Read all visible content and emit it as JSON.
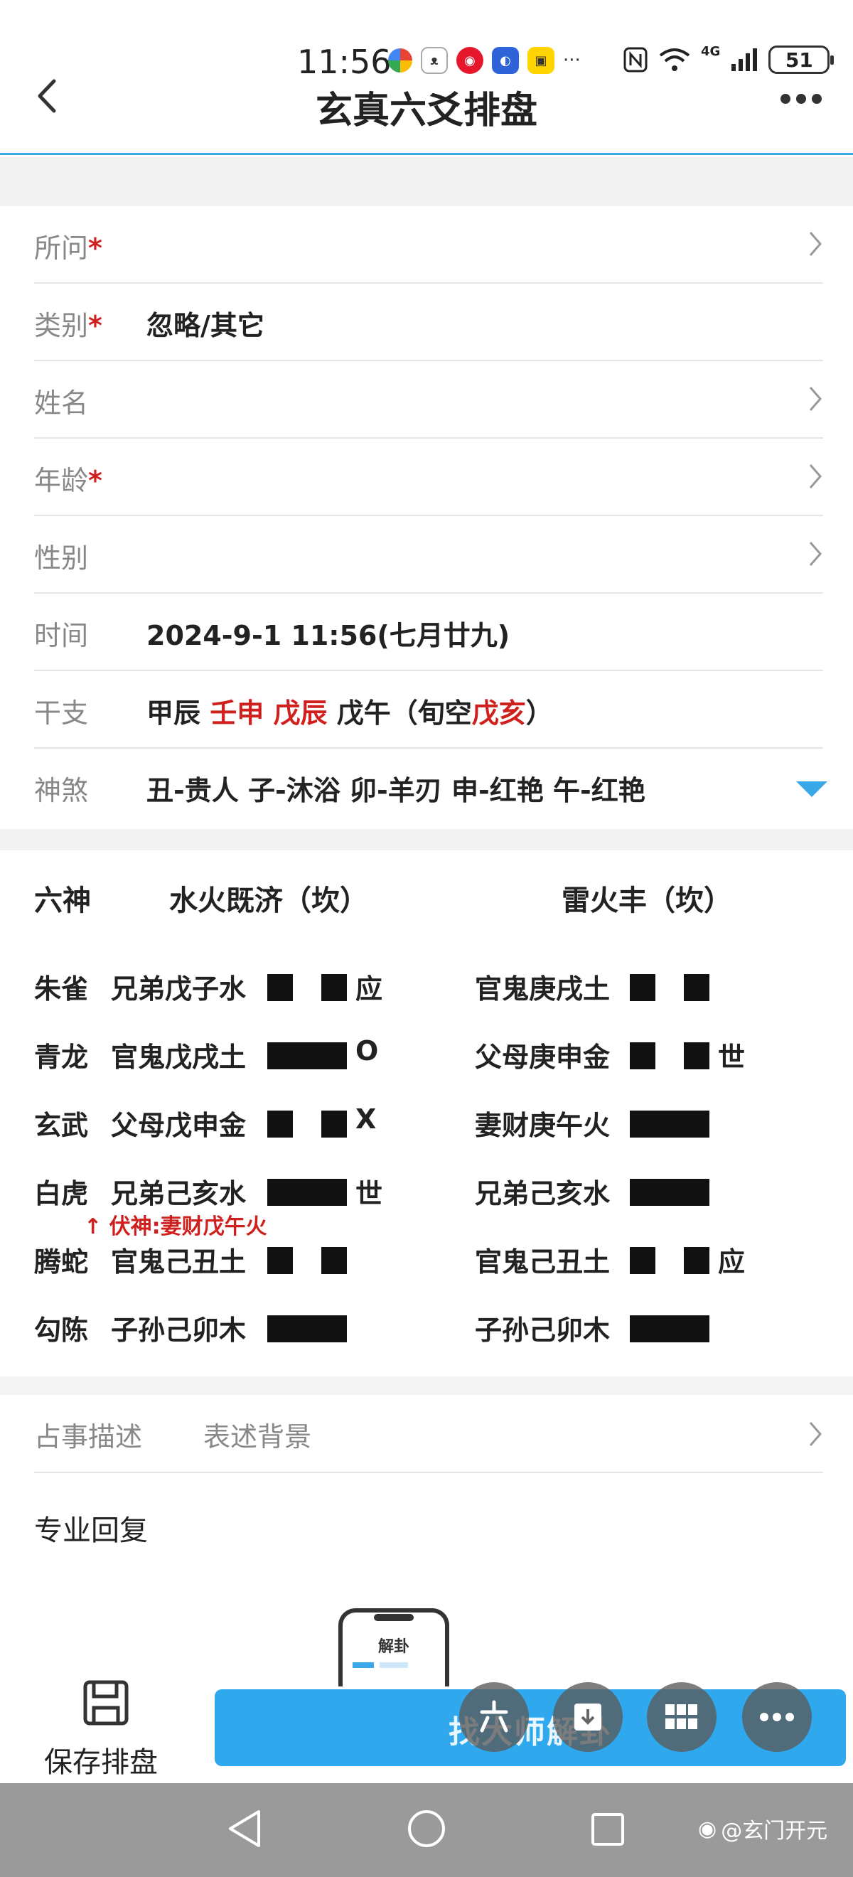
{
  "status_bar": {
    "time": "11:56",
    "network": "4G",
    "battery": "51",
    "app_icons": [
      "colorwheel-app-icon",
      "bear-app-icon",
      "weibo-icon",
      "shield-app-icon",
      "yellow-app-icon"
    ],
    "more": "···"
  },
  "nav": {
    "title": "玄真六爻排盘"
  },
  "form": {
    "required_mark": "*",
    "rows": [
      {
        "label": "所问",
        "value": ""
      },
      {
        "label": "类别",
        "value": "忽略/其它"
      },
      {
        "label": "姓名",
        "value": ""
      },
      {
        "label": "年龄",
        "value": ""
      },
      {
        "label": "性别",
        "value": ""
      },
      {
        "label": "时间",
        "value": "2024-9-1 11:56(七月廿九)"
      },
      {
        "label": "干支",
        "value": ""
      },
      {
        "label": "神煞",
        "value": "丑-贵人 子-沐浴 卯-羊刃 申-红艳 午-红艳"
      }
    ],
    "ganzhi": {
      "year": "甲辰",
      "month": "壬申",
      "day": "戊辰",
      "hour": "戊午",
      "kong_prefix": "（旬空",
      "kong": "戊亥",
      "kong_suffix": "）"
    }
  },
  "hexagram": {
    "header_god": "六神",
    "main_name": "水火既济（坎）",
    "changed_name": "雷火丰（坎）",
    "rows": [
      {
        "god": "朱雀",
        "main": "兄弟戊子水",
        "main_yang": false,
        "main_mark": "应",
        "changed": "官鬼庚戌土",
        "changed_yang": false,
        "changed_mark": ""
      },
      {
        "god": "青龙",
        "main": "官鬼戊戌土",
        "main_yang": true,
        "main_mark": "O",
        "changed": "父母庚申金",
        "changed_yang": false,
        "changed_mark": "世"
      },
      {
        "god": "玄武",
        "main": "父母戊申金",
        "main_yang": false,
        "main_mark": "X",
        "changed": "妻财庚午火",
        "changed_yang": true,
        "changed_mark": ""
      },
      {
        "god": "白虎",
        "main": "兄弟己亥水",
        "main_yang": true,
        "main_mark": "世",
        "changed": "兄弟己亥水",
        "changed_yang": true,
        "changed_mark": ""
      },
      {
        "god": "腾蛇",
        "main": "官鬼己丑土",
        "main_yang": false,
        "main_mark": "",
        "changed": "官鬼己丑土",
        "changed_yang": false,
        "changed_mark": "应"
      },
      {
        "god": "勾陈",
        "main": "子孙己卯木",
        "main_yang": true,
        "main_mark": "",
        "changed": "子孙己卯木",
        "changed_yang": true,
        "changed_mark": ""
      }
    ],
    "fushen": "↑ 伏神:妻财戊午火"
  },
  "description": {
    "label": "占事描述",
    "placeholder": "表述背景"
  },
  "reply": {
    "label": "专业回复"
  },
  "illustration": {
    "label": "解卦"
  },
  "actions": {
    "save_label": "保存排盘",
    "main_button": "找大师解卦"
  },
  "watermark": {
    "text": "@玄门开元"
  },
  "colors": {
    "accent": "#2fa8ee",
    "red": "#d0201e"
  }
}
